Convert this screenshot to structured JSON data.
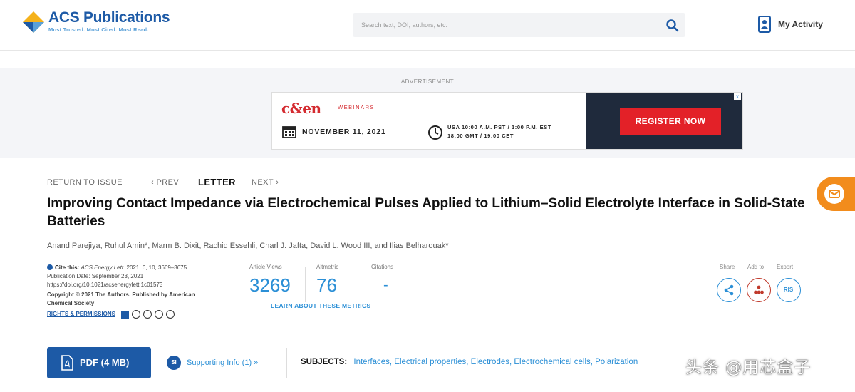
{
  "header": {
    "logo_name": "ACS Publications",
    "logo_tagline": "Most Trusted. Most Cited. Most Read.",
    "search_placeholder": "Search text, DOI, authors, etc.",
    "search_icon": "search-icon",
    "activity_label": "My Activity",
    "activity_icon": "user-badge-icon"
  },
  "advertisement": {
    "label": "ADVERTISEMENT",
    "brand": "c&en",
    "brand_sub": "WEBINARS",
    "date": "NOVEMBER 11, 2021",
    "time_line1": "USA 10:00 A.M. PST / 1:00 P.M. EST",
    "time_line2": "18:00 GMT / 19:00 CET",
    "cta": "REGISTER NOW",
    "close": "x",
    "colors": {
      "brand": "#d42a2f",
      "panel": "#1f2a3c",
      "cta": "#e32128"
    }
  },
  "nav": {
    "return": "RETURN TO ISSUE",
    "prev": "‹ PREV",
    "article_type": "LETTER",
    "next": "NEXT ›"
  },
  "article": {
    "title": "Improving Contact Impedance via Electrochemical Pulses Applied to Lithium–Solid Electrolyte Interface in Solid-State Batteries",
    "authors": "Anand Parejiya, Ruhul Amin*, Marm B. Dixit, Rachid Essehli, Charl J. Jafta, David L. Wood III, and Ilias Belharouak*",
    "cite_label": "Cite this:",
    "cite_journal": "ACS Energy Lett.",
    "cite_ref": "2021, 6, 10, 3669–3675",
    "pub_date": "Publication Date: September 23, 2021",
    "doi": "https://doi.org/10.1021/acsenergylett.1c01573",
    "copyright": "Copyright © 2021 The Authors. Published by American Chemical Society",
    "rights": "RIGHTS & PERMISSIONS"
  },
  "metrics": {
    "views_label": "Article Views",
    "views": "3269",
    "altmetric_label": "Altmetric",
    "altmetric": "76",
    "citations_label": "Citations",
    "citations": "-",
    "learn": "LEARN ABOUT THESE METRICS"
  },
  "tools": {
    "share_label": "Share",
    "add_label": "Add to",
    "export_label": "Export",
    "export_btn": "RIS"
  },
  "actions": {
    "pdf": "PDF (4 MB)",
    "supp_icon": "SI",
    "supp": "Supporting Info (1) »",
    "subjects_label": "SUBJECTS:",
    "subjects": "Interfaces, Electrical properties, Electrodes, Electrochemical cells, Polarization"
  },
  "watermark": "头条 @用芯盒子"
}
